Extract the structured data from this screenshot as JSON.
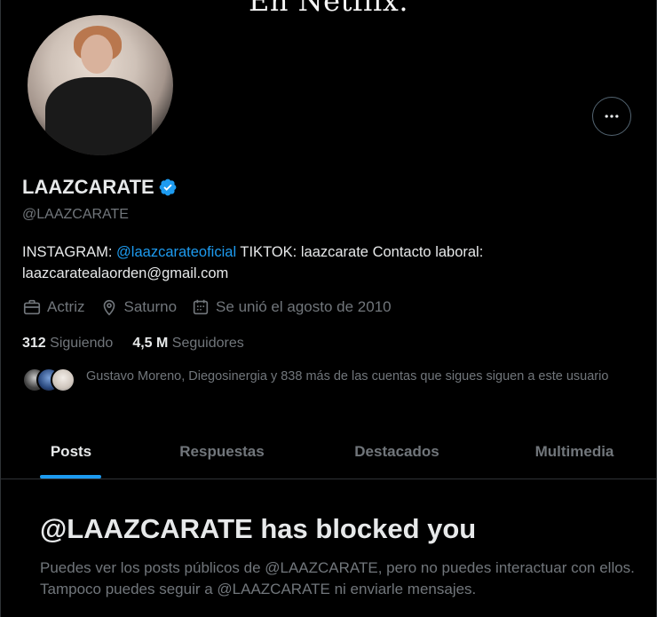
{
  "banner": {
    "text": "En Netflix."
  },
  "profile": {
    "display_name": "LAAZCARATE",
    "handle": "@LAAZCARATE",
    "bio_prefix": "INSTAGRAM: ",
    "bio_link": "@laazcarateoficial",
    "bio_suffix": " TIKTOK: laazcarate Contacto laboral: laazcaratealaorden@gmail.com",
    "profession": "Actriz",
    "location": "Saturno",
    "joined": "Se unió el agosto de 2010",
    "following_count": "312",
    "following_label": "Siguiendo",
    "followers_count": "4,5 M",
    "followers_label": "Seguidores",
    "followers_you_know": "Gustavo Moreno, Diegosinergia y 838 más de las cuentas que sigues siguen a este usuario"
  },
  "tabs": [
    {
      "label": "Posts",
      "active": true
    },
    {
      "label": "Respuestas",
      "active": false
    },
    {
      "label": "Destacados",
      "active": false
    },
    {
      "label": "Multimedia",
      "active": false
    }
  ],
  "blocked": {
    "title": "@LAAZCARATE has blocked you",
    "description": "Puedes ver los posts públicos de @LAAZCARATE, pero no puedes interactuar con ellos. Tampoco puedes seguir a @LAAZCARATE ni enviarle mensajes."
  },
  "icons": {
    "more": "more-horizontal-icon",
    "verified": "verified-badge-icon",
    "profession": "briefcase-icon",
    "location": "location-pin-icon",
    "joined": "calendar-icon"
  },
  "colors": {
    "background": "#000000",
    "accent": "#1d9bf0",
    "text_primary": "#e7e9ea",
    "text_secondary": "#71767b",
    "border": "#2f3336"
  }
}
